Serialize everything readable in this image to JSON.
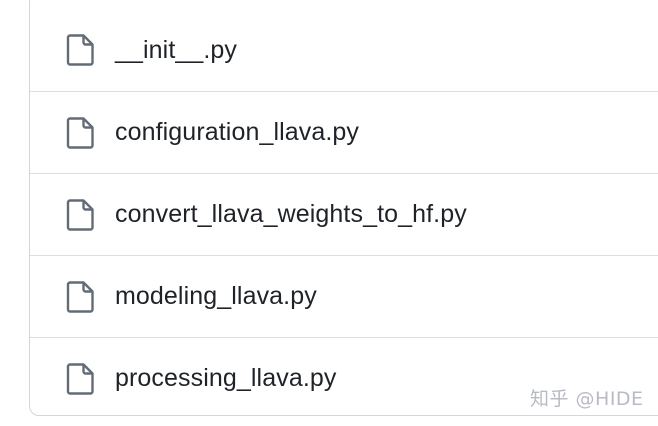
{
  "files": [
    {
      "name": "__init__.py",
      "icon": "file-icon"
    },
    {
      "name": "configuration_llava.py",
      "icon": "file-icon"
    },
    {
      "name": "convert_llava_weights_to_hf.py",
      "icon": "file-icon"
    },
    {
      "name": "modeling_llava.py",
      "icon": "file-icon"
    },
    {
      "name": "processing_llava.py",
      "icon": "file-icon"
    }
  ],
  "watermark": "知乎 @HIDE",
  "colors": {
    "border": "#d0d7de",
    "text": "#1f2328",
    "icon": "#636c76",
    "watermark": "#b8bcc2"
  }
}
